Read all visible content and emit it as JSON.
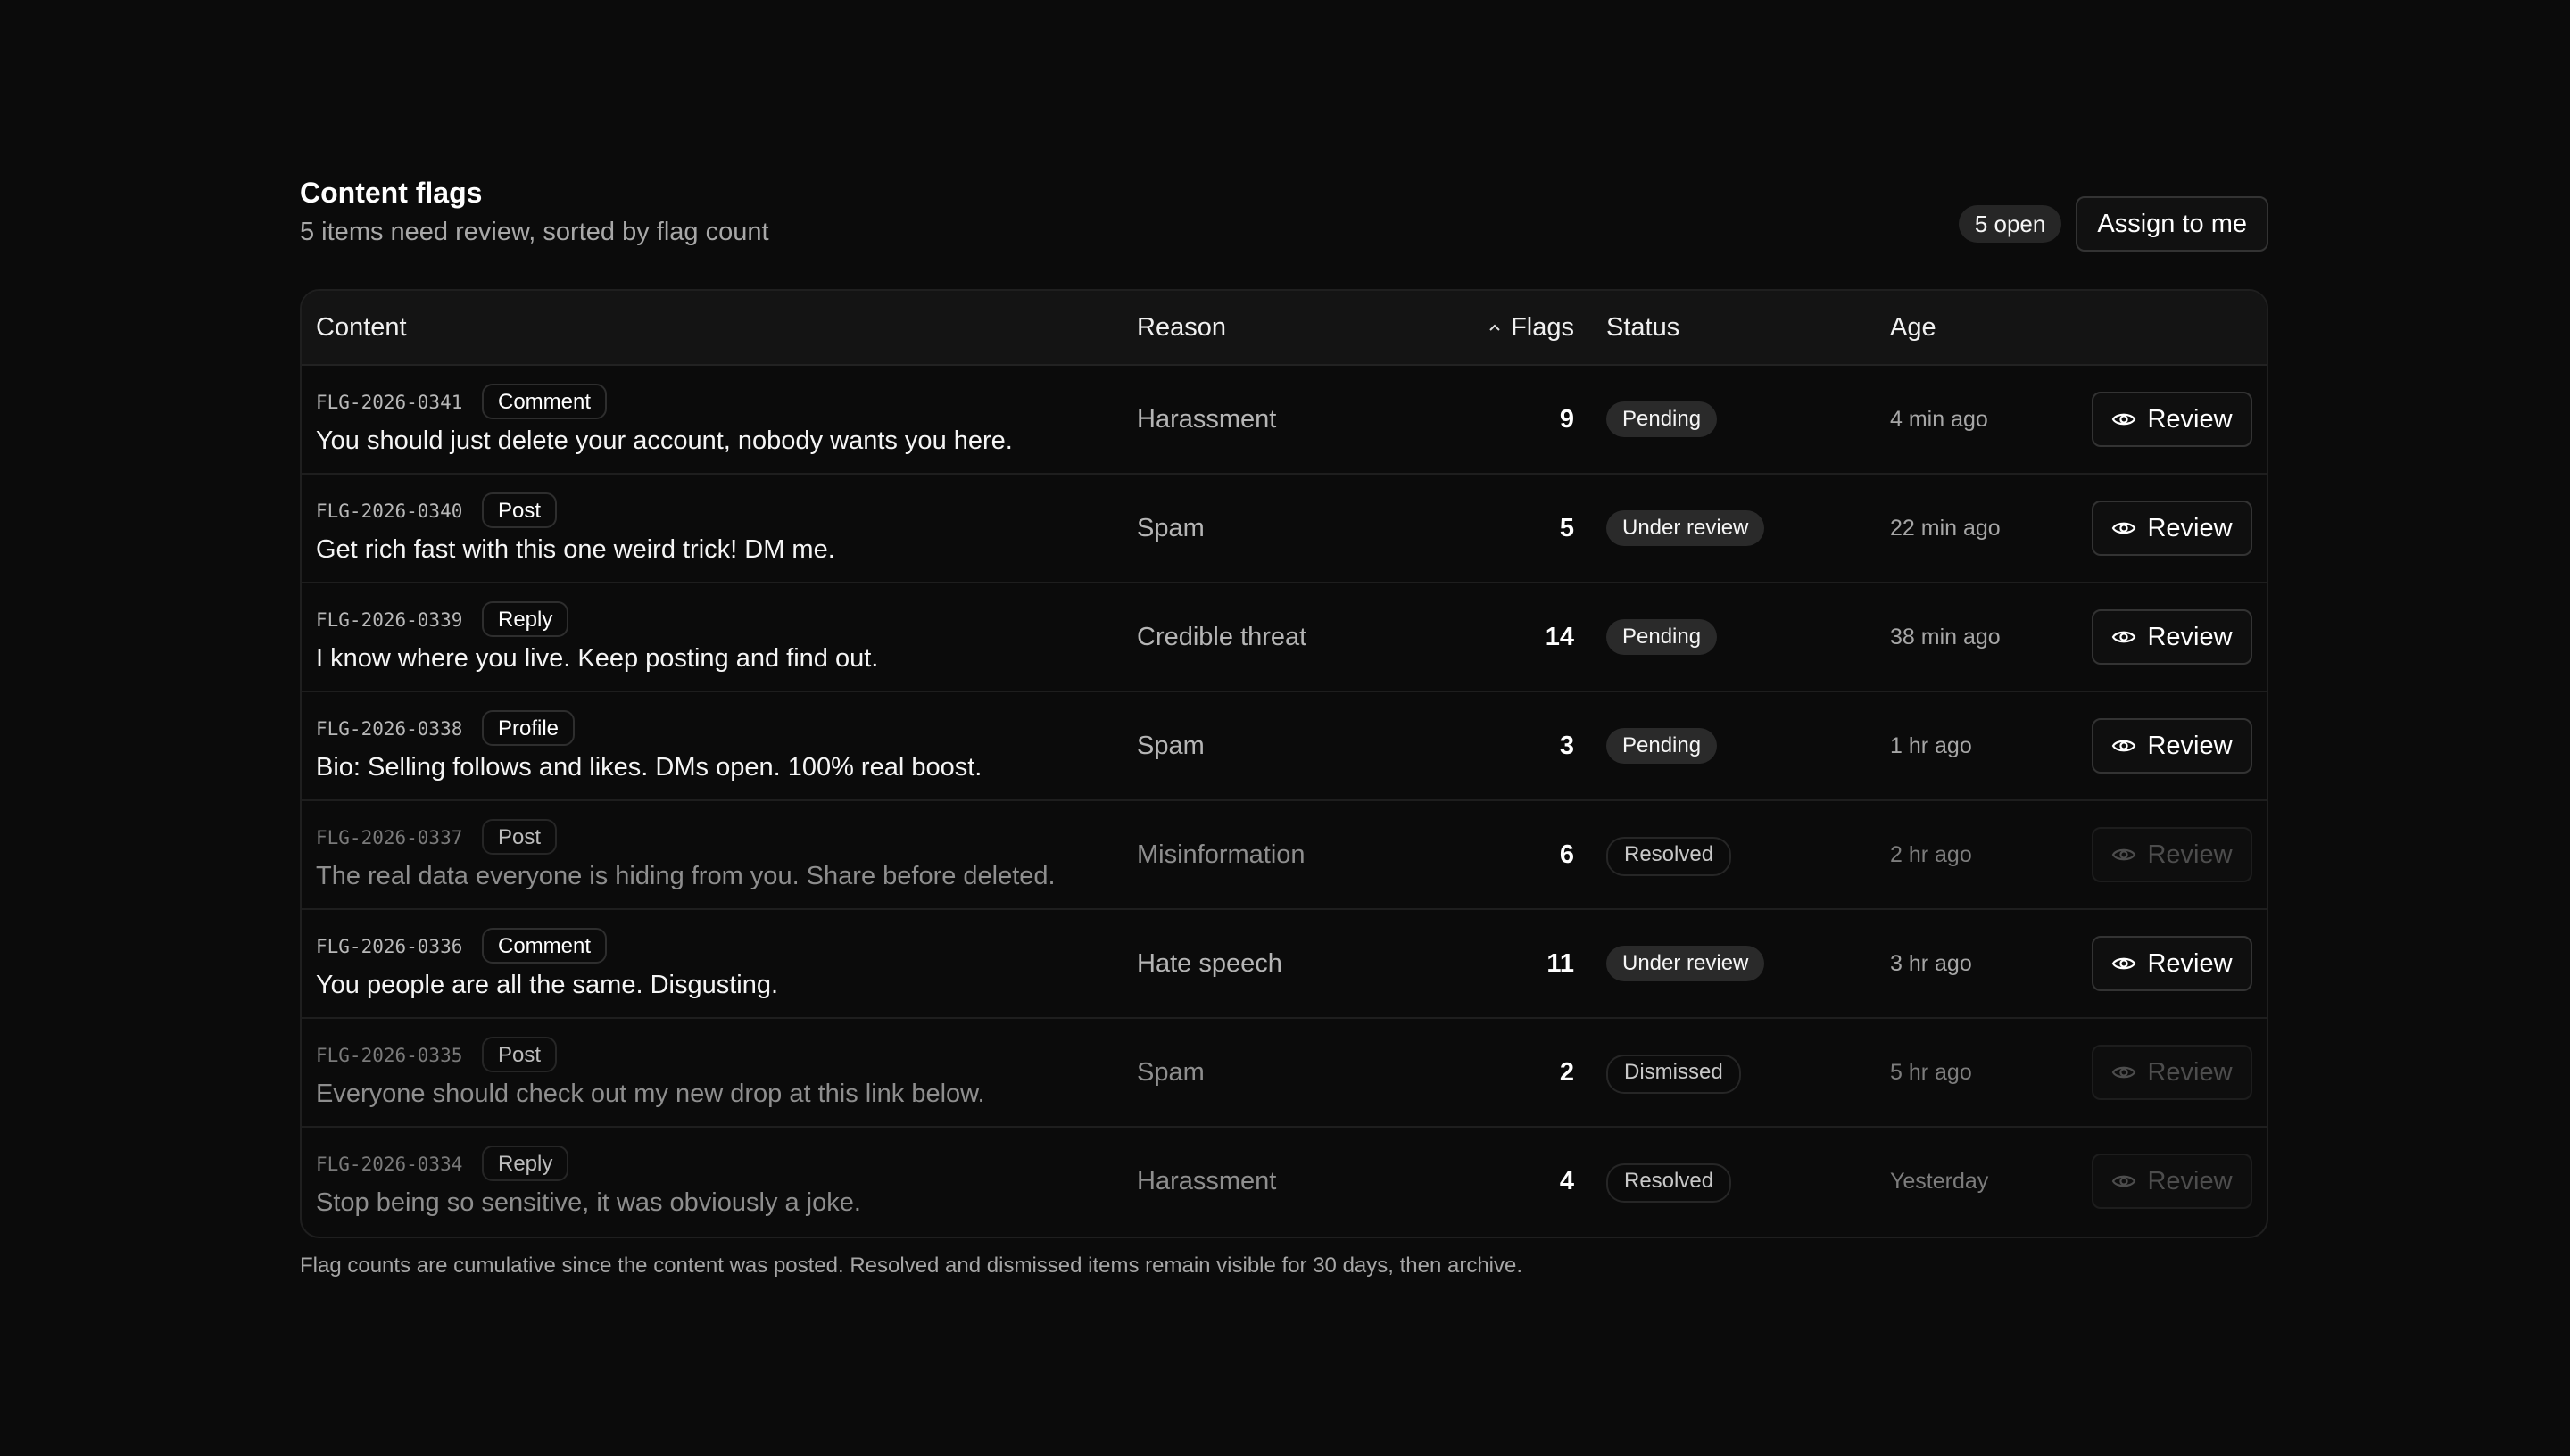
{
  "header": {
    "title": "Content flags",
    "subtitle": "5 items need review, sorted by flag count",
    "open_badge": "5 open",
    "assign_label": "Assign to me"
  },
  "columns": {
    "content": "Content",
    "reason": "Reason",
    "flags": "Flags",
    "status": "Status",
    "age": "Age"
  },
  "rows": [
    {
      "id": "FLG-2026-0341",
      "type": "Comment",
      "text": "You should just delete your account, nobody wants you here.",
      "reason": "Harassment",
      "flags": "9",
      "status": "Pending",
      "age": "4 min ago",
      "action": "Review"
    },
    {
      "id": "FLG-2026-0340",
      "type": "Post",
      "text": "Get rich fast with this one weird trick! DM me.",
      "reason": "Spam",
      "flags": "5",
      "status": "Under review",
      "age": "22 min ago",
      "action": "Review"
    },
    {
      "id": "FLG-2026-0339",
      "type": "Reply",
      "text": "I know where you live. Keep posting and find out.",
      "reason": "Credible threat",
      "flags": "14",
      "status": "Pending",
      "age": "38 min ago",
      "action": "Review"
    },
    {
      "id": "FLG-2026-0338",
      "type": "Profile",
      "text": "Bio: Selling follows and likes. DMs open. 100% real boost.",
      "reason": "Spam",
      "flags": "3",
      "status": "Pending",
      "age": "1 hr ago",
      "action": "Review"
    },
    {
      "id": "FLG-2026-0337",
      "type": "Post",
      "text": "The real data everyone is hiding from you. Share before deleted.",
      "reason": "Misinformation",
      "flags": "6",
      "status": "Resolved",
      "age": "2 hr ago",
      "action": "Review"
    },
    {
      "id": "FLG-2026-0336",
      "type": "Comment",
      "text": "You people are all the same. Disgusting.",
      "reason": "Hate speech",
      "flags": "11",
      "status": "Under review",
      "age": "3 hr ago",
      "action": "Review"
    },
    {
      "id": "FLG-2026-0335",
      "type": "Post",
      "text": "Everyone should check out my new drop at this link below.",
      "reason": "Spam",
      "flags": "2",
      "status": "Dismissed",
      "age": "5 hr ago",
      "action": "Review"
    },
    {
      "id": "FLG-2026-0334",
      "type": "Reply",
      "text": "Stop being so sensitive, it was obviously a joke.",
      "reason": "Harassment",
      "flags": "4",
      "status": "Resolved",
      "age": "Yesterday",
      "action": "Review"
    }
  ],
  "footnote": "Flag counts are cumulative since the content was posted. Resolved and dismissed items remain visible for 30 days, then archive."
}
